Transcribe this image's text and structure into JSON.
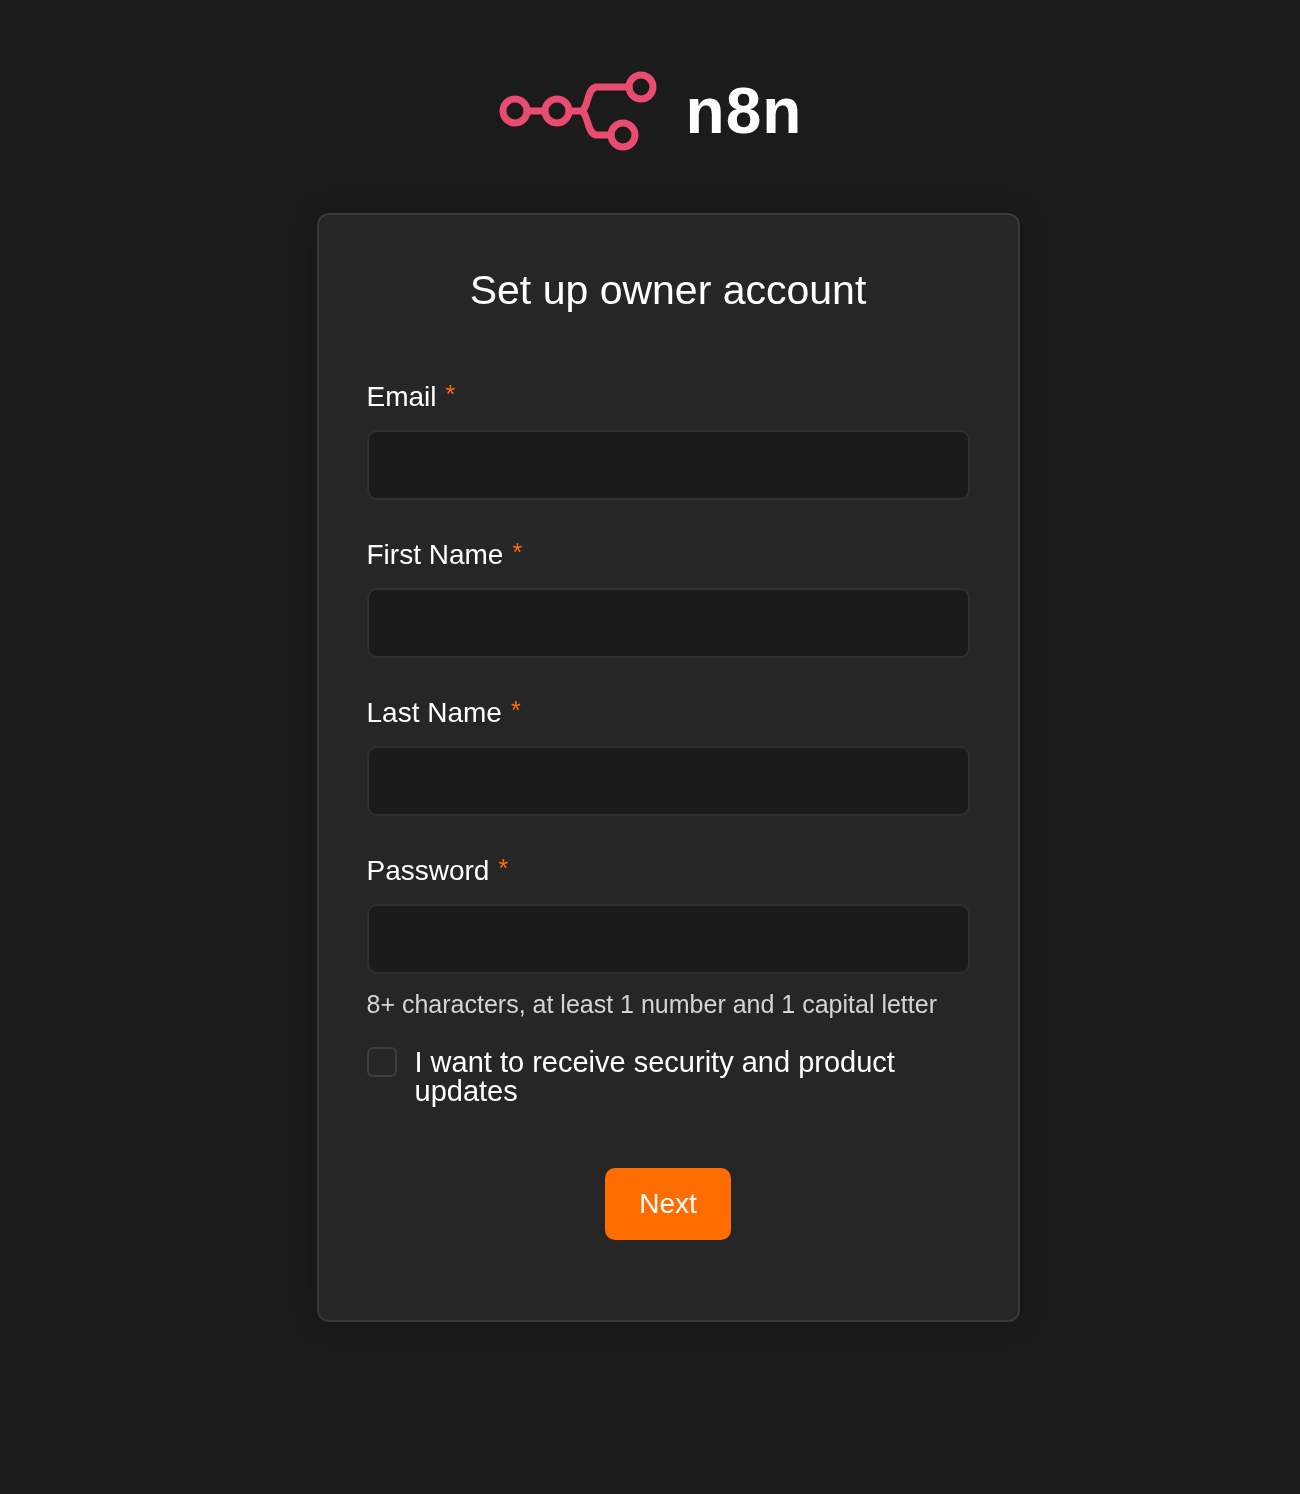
{
  "logo": {
    "wordmark": "n8n"
  },
  "form": {
    "title": "Set up owner account",
    "fields": [
      {
        "label": "Email",
        "required_mark": "*"
      },
      {
        "label": "First Name",
        "required_mark": "*"
      },
      {
        "label": "Last Name",
        "required_mark": "*"
      },
      {
        "label": "Password",
        "required_mark": "*",
        "hint": "8+ characters, at least 1 number and 1 capital letter"
      }
    ],
    "consent": {
      "label": "I want to receive security and product updates",
      "checked": false
    },
    "submit": {
      "label": "Next"
    }
  }
}
